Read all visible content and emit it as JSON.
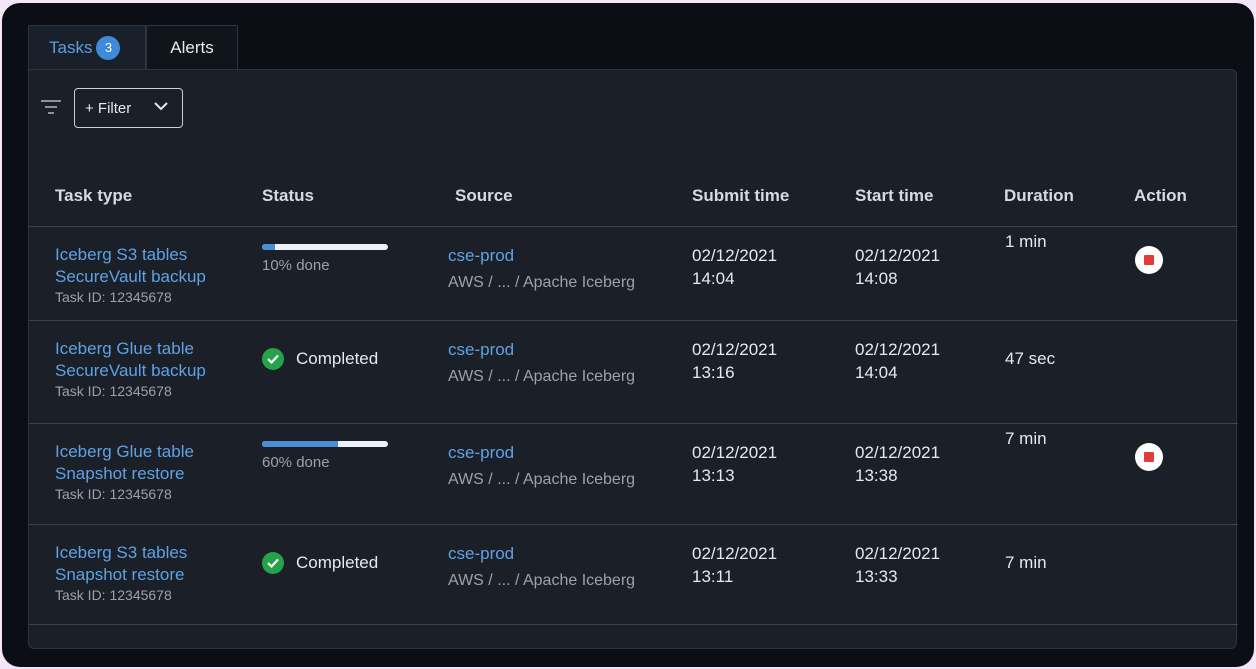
{
  "tabs": [
    {
      "label": "Tasks",
      "count": "3",
      "active": true
    },
    {
      "label": "Alerts",
      "active": false
    }
  ],
  "toolbar": {
    "filter_label": "+ Filter",
    "filter_icon": "filter-lines-icon"
  },
  "columns": [
    "Task type",
    "Status",
    "Source",
    "Submit time",
    "Start time",
    "Duration",
    "Action"
  ],
  "colors": {
    "link": "#5fa2e3",
    "progress": "#4a8fd6",
    "success": "#25a24a",
    "stop": "#e23b3b"
  },
  "rows": [
    {
      "name1": "Iceberg S3 tables",
      "name2": "SecureVault backup",
      "task_id": "Task ID: 12345678",
      "status_type": "progress",
      "progress": 0.1,
      "status_text": "10% done",
      "source": "cse-prod",
      "source_path": "AWS / ... / Apache Iceberg",
      "submit_date": "02/12/2021",
      "submit_time": "14:04",
      "start_date": "02/12/2021",
      "start_time": "14:08",
      "duration": "1 min",
      "action": "stop-icon"
    },
    {
      "name1": "Iceberg Glue table",
      "name2": "SecureVault backup",
      "task_id": "Task ID: 12345678",
      "status_type": "done",
      "status_text": "Completed",
      "source": "cse-prod",
      "source_path": "AWS / ... / Apache Iceberg",
      "submit_date": "02/12/2021",
      "submit_time": "13:16",
      "start_date": "02/12/2021",
      "start_time": "14:04",
      "duration": "47 sec",
      "action": ""
    },
    {
      "name1": "Iceberg Glue table",
      "name2": "Snapshot restore",
      "task_id": "Task ID: 12345678",
      "status_type": "progress",
      "progress": 0.6,
      "status_text": "60% done",
      "source": "cse-prod",
      "source_path": "AWS / ... / Apache Iceberg",
      "submit_date": "02/12/2021",
      "submit_time": "13:13",
      "start_date": "02/12/2021",
      "start_time": "13:38",
      "duration": "7 min",
      "action": "stop-icon"
    },
    {
      "name1": "Iceberg S3 tables",
      "name2": "Snapshot restore",
      "task_id": "Task ID: 12345678",
      "status_type": "done",
      "status_text": "Completed",
      "source": "cse-prod",
      "source_path": "AWS / ... / Apache Iceberg",
      "submit_date": "02/12/2021",
      "submit_time": "13:11",
      "start_date": "02/12/2021",
      "start_time": "13:33",
      "duration": "7 min",
      "action": ""
    }
  ]
}
